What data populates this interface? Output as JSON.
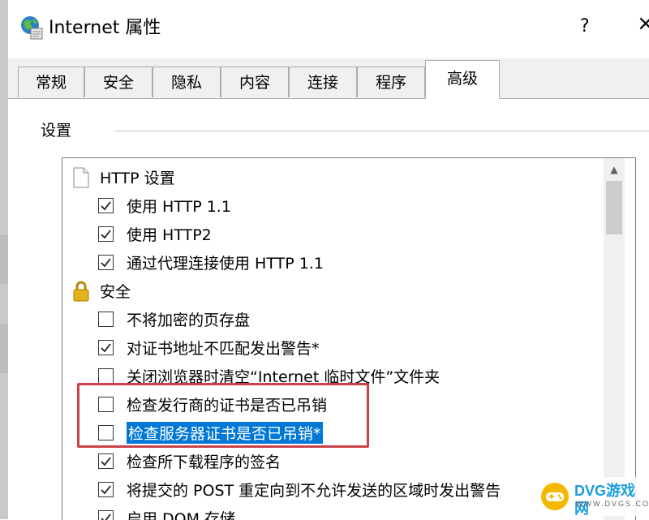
{
  "window": {
    "title": "Internet 属性",
    "help": "?",
    "close": "×"
  },
  "tabs": [
    "常规",
    "安全",
    "隐私",
    "内容",
    "连接",
    "程序",
    "高级"
  ],
  "active_tab": "高级",
  "settings_label": "设置",
  "list": [
    {
      "kind": "group",
      "icon": "page-icon",
      "label": "HTTP 设置"
    },
    {
      "kind": "option",
      "checked": true,
      "label": "使用 HTTP 1.1"
    },
    {
      "kind": "option",
      "checked": true,
      "label": "使用 HTTP2"
    },
    {
      "kind": "option",
      "checked": true,
      "label": "通过代理连接使用 HTTP 1.1"
    },
    {
      "kind": "group",
      "icon": "lock-icon",
      "label": "安全"
    },
    {
      "kind": "option",
      "checked": false,
      "label": "不将加密的页存盘"
    },
    {
      "kind": "option",
      "checked": true,
      "label": "对证书地址不匹配发出警告*"
    },
    {
      "kind": "option",
      "checked": false,
      "label": "关闭浏览器时清空“Internet 临时文件”文件夹"
    },
    {
      "kind": "option",
      "checked": false,
      "label": "检查发行商的证书是否已吊销"
    },
    {
      "kind": "option",
      "checked": false,
      "selected": true,
      "label": "检查服务器证书是否已吊销*"
    },
    {
      "kind": "option",
      "checked": true,
      "label": "检查所下载程序的签名"
    },
    {
      "kind": "option",
      "checked": true,
      "label": "将提交的 POST 重定向到不允许发送的区域时发出警告"
    },
    {
      "kind": "option",
      "checked": true,
      "label": "启用 DOM 存储"
    }
  ],
  "colors": {
    "selection": "#0078d7",
    "highlight_box": "#c9424a",
    "watermark": "#1a9de0"
  },
  "watermark": {
    "text": "DVG游戏网",
    "sub": "WWW.DVGS.COM"
  }
}
